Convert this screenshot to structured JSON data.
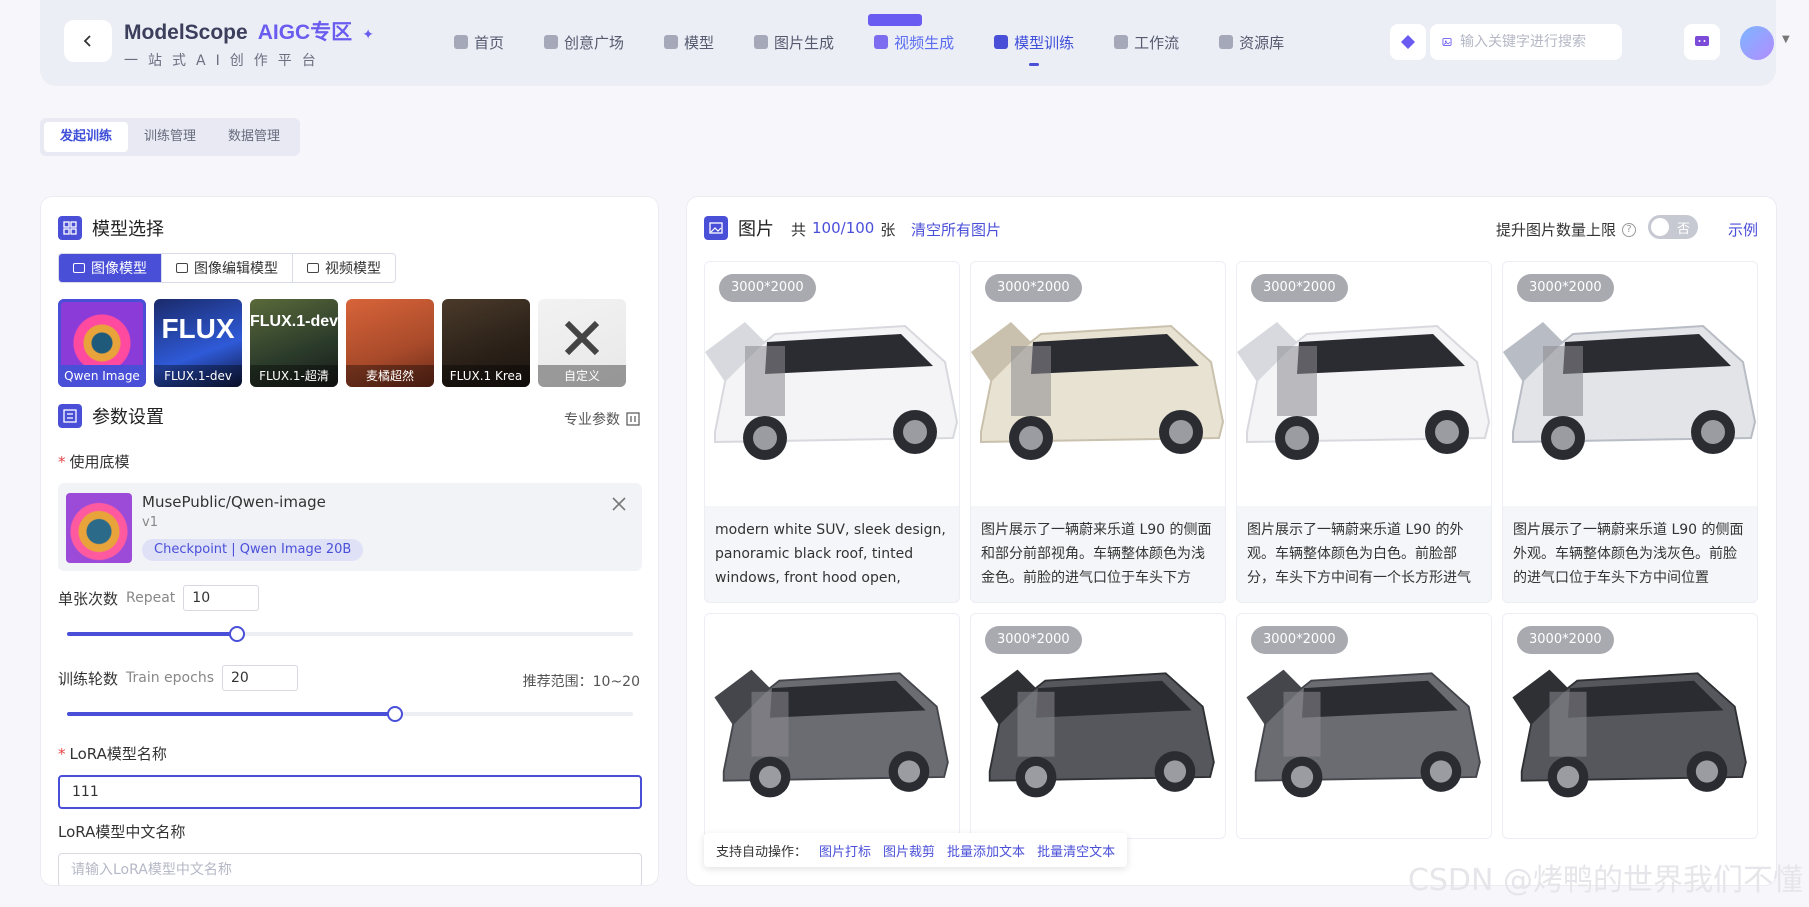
{
  "header": {
    "brand_name": "ModelScope",
    "brand_aigc": "AIGC专区",
    "brand_sub": "一站式AI创作平台",
    "nav": [
      {
        "label": "首页",
        "icon": "home-icon",
        "style": "normal"
      },
      {
        "label": "创意广场",
        "icon": "flask-icon",
        "style": "normal"
      },
      {
        "label": "模型",
        "icon": "cube-icon",
        "style": "normal"
      },
      {
        "label": "图片生成",
        "icon": "image-icon",
        "style": "normal"
      },
      {
        "label": "视频生成",
        "icon": "video-icon",
        "style": "blue"
      },
      {
        "label": "模型训练",
        "icon": "train-icon",
        "style": "active"
      },
      {
        "label": "工作流",
        "icon": "workflow-icon",
        "style": "normal"
      },
      {
        "label": "资源库",
        "icon": "library-icon",
        "style": "normal"
      }
    ],
    "search_placeholder": "输入关键字进行搜索"
  },
  "subtabs": [
    "发起训练",
    "训练管理",
    "数据管理"
  ],
  "left": {
    "model_select_title": "模型选择",
    "model_tabs": [
      "图像模型",
      "图像编辑模型",
      "视频模型"
    ],
    "model_cards": [
      {
        "label": "Qwen Image",
        "selected": true
      },
      {
        "label": "FLUX.1-dev",
        "big": "FLUX"
      },
      {
        "label": "FLUX.1-超清",
        "big": "FLUX.1-dev"
      },
      {
        "label": "麦橘超然"
      },
      {
        "label": "FLUX.1 Krea"
      },
      {
        "label": "自定义"
      }
    ],
    "params_title": "参数设置",
    "pro_params": "专业参数",
    "base_model_label": "使用底模",
    "base_model": {
      "name": "MusePublic/Qwen-image",
      "version": "v1",
      "tag": "Checkpoint | Qwen Image 20B"
    },
    "repeat": {
      "label": "单张次数",
      "en": "Repeat",
      "value": "10",
      "fraction": 0.3
    },
    "epochs": {
      "label": "训练轮数",
      "en": "Train epochs",
      "value": "20",
      "hint": "推荐范围：10~20",
      "fraction": 0.58
    },
    "lora_name_label": "LoRA模型名称",
    "lora_name_value": "111",
    "lora_cn_label": "LoRA模型中文名称",
    "lora_cn_placeholder": "请输入LoRA模型中文名称"
  },
  "right": {
    "title": "图片",
    "count_prefix": "共",
    "count": "100/100",
    "count_suffix": "张",
    "clear_all": "清空所有图片",
    "boost_label": "提升图片数量上限",
    "toggle_text": "否",
    "example": "示例",
    "images": [
      {
        "res": "3000*2000",
        "caption": "modern white SUV, sleek design, panoramic black roof, tinted windows, front hood open, engine bay visible",
        "car": "white"
      },
      {
        "res": "3000*2000",
        "caption": "图片展示了一辆蔚来乐道 L90 的侧面和部分前部视角。车辆整体颜色为浅金色。前脸的进气口位于车头下方",
        "car": "cream"
      },
      {
        "res": "3000*2000",
        "caption": "图片展示了一辆蔚来乐道 L90 的外观。车辆整体颜色为白色。前脸部分，车头下方中间有一个长方形进气口",
        "car": "white"
      },
      {
        "res": "3000*2000",
        "caption": "图片展示了一辆蔚来乐道 L90 的侧面外观。车辆整体颜色为浅灰色。前脸的进气口位于车头下方中间位置",
        "car": "silver"
      },
      {
        "res": "",
        "caption": "",
        "car": "gray"
      },
      {
        "res": "3000*2000",
        "caption": "",
        "car": "dark"
      },
      {
        "res": "3000*2000",
        "caption": "",
        "car": "gray"
      },
      {
        "res": "3000*2000",
        "caption": "",
        "car": "dark"
      }
    ],
    "auto_ops_label": "支持自动操作：",
    "auto_ops": [
      "图片打标",
      "图片裁剪",
      "批量添加文本",
      "批量清空文本"
    ]
  },
  "watermark": "CSDN @烤鸭的世界我们不懂",
  "colors": {
    "accent": "#4a4fd8",
    "brand": "#6a5cf0"
  }
}
